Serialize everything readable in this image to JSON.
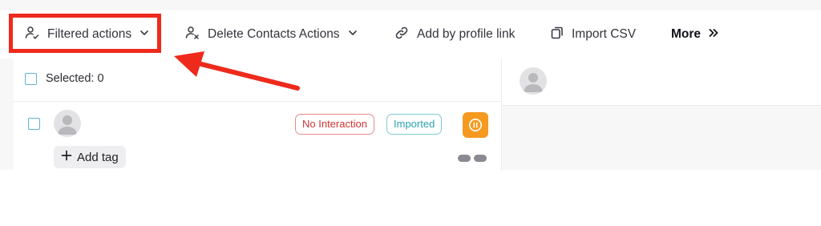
{
  "toolbar": {
    "filtered_actions_label": "Filtered actions",
    "delete_contacts_label": "Delete Contacts Actions",
    "add_by_link_label": "Add by profile link",
    "import_csv_label": "Import CSV",
    "more_label": "More"
  },
  "list": {
    "selected_label": "Selected: 0",
    "contact": {
      "status_badge": "No Interaction",
      "source_badge": "Imported",
      "add_tag_label": "Add tag"
    }
  },
  "colors": {
    "highlight": "#ee2a1c",
    "pause_button": "#f59a1f",
    "badge_red": "#d33232",
    "badge_teal": "#2aa3b1",
    "checkbox": "#5fb4d3"
  },
  "icons": {
    "filtered_actions": "user-check-icon",
    "delete_contacts": "user-x-icon",
    "add_by_link": "link-icon",
    "import_csv": "copy-icon",
    "more": "double-chevron-right-icon",
    "pause": "pause-circle-icon",
    "add_tag": "plus-icon"
  }
}
